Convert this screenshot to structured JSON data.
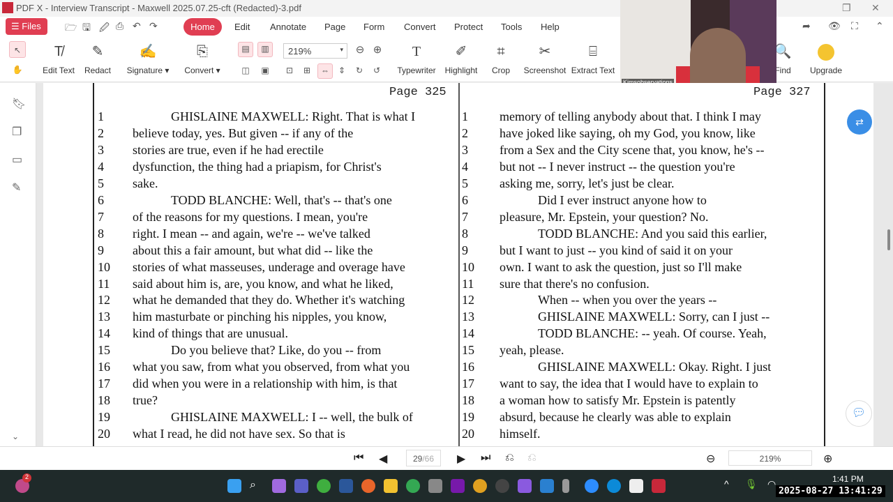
{
  "window": {
    "title": "PDF X - Interview Transcript - Maxwell 2025.07.25-cft (Redacted)-3.pdf"
  },
  "menu": {
    "files": "Files",
    "items": [
      "Home",
      "Edit",
      "Annotate",
      "Page",
      "Form",
      "Convert",
      "Protect",
      "Tools",
      "Help"
    ]
  },
  "toolbar": {
    "edit_text": "Edit Text",
    "redact": "Redact",
    "signature": "Signature ▾",
    "convert": "Convert ▾",
    "zoom": "219%",
    "typewriter": "Typewriter",
    "highlight": "Highlight",
    "crop": "Crop",
    "screenshot": "Screenshot",
    "extract_text": "Extract Text",
    "find": "Find",
    "upgrade": "Upgrade"
  },
  "webcam": {
    "label": "Kimsobservations"
  },
  "left_page": {
    "header": "Page 325",
    "lines": [
      {
        "n": "1",
        "t": "GHISLAINE MAXWELL:  Right.  That is what I",
        "indent": true
      },
      {
        "n": "2",
        "t": "believe today, yes.  But given -- if any of the"
      },
      {
        "n": "3",
        "t": "stories are true, even if he had erectile"
      },
      {
        "n": "4",
        "t": "dysfunction, the thing had a priapism, for Christ's"
      },
      {
        "n": "5",
        "t": "sake."
      },
      {
        "n": "6",
        "t": "TODD BLANCHE:  Well, that's -- that's one",
        "indent": true
      },
      {
        "n": "7",
        "t": "of the reasons for my questions.  I mean, you're"
      },
      {
        "n": "8",
        "t": "right.  I mean -- and again, we're -- we've talked"
      },
      {
        "n": "9",
        "t": "about this a fair amount, but what did -- like the"
      },
      {
        "n": "10",
        "t": "stories of what masseuses, underage and overage have"
      },
      {
        "n": "11",
        "t": "said about him is, are, you know, and what he liked,"
      },
      {
        "n": "12",
        "t": "what he demanded that they do.  Whether it's watching"
      },
      {
        "n": "13",
        "t": "him masturbate or pinching his nipples, you know,"
      },
      {
        "n": "14",
        "t": "kind of things that are unusual."
      },
      {
        "n": "15",
        "t": "Do you believe that?  Like, do you -- from",
        "indent": true
      },
      {
        "n": "16",
        "t": "what you saw, from what you observed, from what you"
      },
      {
        "n": "17",
        "t": "did when you were in a relationship with him, is that"
      },
      {
        "n": "18",
        "t": "true?"
      },
      {
        "n": "19",
        "t": "GHISLAINE MAXWELL:  I -- well, the bulk of",
        "indent": true
      },
      {
        "n": "20",
        "t": "what I read, he did not have sex.  So that is"
      }
    ]
  },
  "right_page": {
    "header": "Page 327",
    "lines": [
      {
        "n": "1",
        "t": "memory of telling anybody about that.  I think I may"
      },
      {
        "n": "2",
        "t": "have joked like saying, oh my God, you know, like"
      },
      {
        "n": "3",
        "t": "from a Sex and the City scene that, you know, he's --"
      },
      {
        "n": "4",
        "t": "but not -- I never instruct -- the question you're"
      },
      {
        "n": "5",
        "t": "asking me, sorry, let's just be clear."
      },
      {
        "n": "6",
        "t": "Did I ever instruct anyone how to",
        "indent": true
      },
      {
        "n": "7",
        "t": "pleasure, Mr. Epstein, your question?  No."
      },
      {
        "n": "8",
        "t": "TODD BLANCHE:  And you said this earlier,",
        "indent": true
      },
      {
        "n": "9",
        "t": "but I want to just -- you kind of said it on your"
      },
      {
        "n": "10",
        "t": "own.  I want to ask the question, just so I'll make"
      },
      {
        "n": "11",
        "t": "sure that there's no confusion."
      },
      {
        "n": "12",
        "t": "When -- when you over the years --",
        "indent": true
      },
      {
        "n": "13",
        "t": "GHISLAINE MAXWELL:  Sorry, can I just --",
        "indent": true
      },
      {
        "n": "14",
        "t": "TODD BLANCHE:  -- yeah.  Of course.  Yeah,",
        "indent": true
      },
      {
        "n": "15",
        "t": "yeah, please."
      },
      {
        "n": "16",
        "t": "GHISLAINE MAXWELL:  Okay.  Right.  I just",
        "indent": true
      },
      {
        "n": "17",
        "t": "want to say, the idea that I would have to explain to"
      },
      {
        "n": "18",
        "t": "a woman how to satisfy Mr. Epstein is patently"
      },
      {
        "n": "19",
        "t": "absurd, because he clearly was able to explain"
      },
      {
        "n": "20",
        "t": "himself."
      }
    ]
  },
  "statusbar": {
    "page_current": "29",
    "page_total": "/66",
    "zoom": "219%"
  },
  "taskbar": {
    "badge": "2",
    "time": "1:41 PM",
    "timestamp": "2025-08-27 13:41:29"
  },
  "colors": {
    "accent": "#e03e52"
  }
}
